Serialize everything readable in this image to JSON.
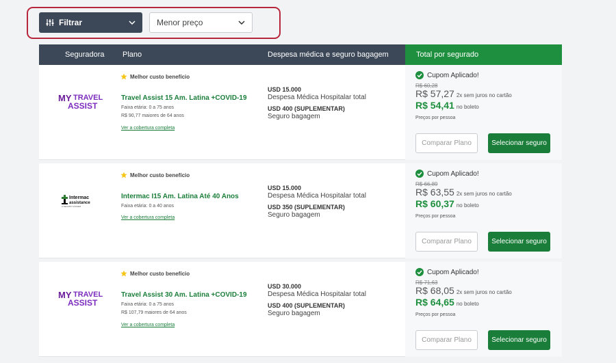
{
  "toolbar": {
    "filter_label": "Filtrar",
    "sort_value": "Menor preço"
  },
  "table_header": {
    "insurer": "Seguradora",
    "plan": "Plano",
    "coverage": "Despesa médica e seguro bagagem",
    "total": "Total por segurado"
  },
  "colors": {
    "dark": "#3c4858",
    "green": "#1e8f3e",
    "highlight": "#b8263c"
  },
  "cards": [
    {
      "logo": "MYTRAVEL ASSIST",
      "badge": "Melhor custo benefício",
      "name": "Travel Assist 15 Am. Latina +COVID-19",
      "age": "Faixa etária: 0 a 75 anos",
      "extra": "R$ 90,77 maiores de 64 anos",
      "link": "Ver a cobertura completa",
      "medical_amount": "USD 15.000",
      "medical_label": "Despesa Médica Hospitalar total",
      "baggage_amount": "USD 400 (SUPLEMENTAR)",
      "baggage_label": "Seguro bagagem",
      "coupon": "Cupom Aplicado!",
      "old_price": "R$ 60,28",
      "card_price": "R$ 57,27",
      "card_terms": "2x sem juros no cartão",
      "boleto_price": "R$ 54,41",
      "boleto_label": "no boleto",
      "per_person": "Preços por pessoa",
      "compare": "Comparar Plano",
      "select": "Selecionar seguro"
    },
    {
      "logo": "Intermac assistance",
      "badge": "Melhor custo benefício",
      "name": "Intermac I15 Am. Latina Até 40 Anos",
      "age": "Faixa etária: 0 a 40 anos",
      "extra": "",
      "link": "Ver a cobertura completa",
      "medical_amount": "USD 15.000",
      "medical_label": "Despesa Médica Hospitalar total",
      "baggage_amount": "USD 350 (SUPLEMENTAR)",
      "baggage_label": "Seguro bagagem",
      "coupon": "Cupom Aplicado!",
      "old_price": "R$ 66,89",
      "card_price": "R$ 63,55",
      "card_terms": "2x sem juros no cartão",
      "boleto_price": "R$ 60,37",
      "boleto_label": "no boleto",
      "per_person": "Preços por pessoa",
      "compare": "Comparar Plano",
      "select": "Selecionar seguro"
    },
    {
      "logo": "MYTRAVEL ASSIST",
      "badge": "Melhor custo benefício",
      "name": "Travel Assist 30 Am. Latina +COVID-19",
      "age": "Faixa etária: 0 a 75 anos",
      "extra": "R$ 107,79 maiores de 64 anos",
      "link": "Ver a cobertura completa",
      "medical_amount": "USD 30.000",
      "medical_label": "Despesa Médica Hospitalar total",
      "baggage_amount": "USD 400 (SUPLEMENTAR)",
      "baggage_label": "Seguro bagagem",
      "coupon": "Cupom Aplicado!",
      "old_price": "R$ 71,63",
      "card_price": "R$ 68,05",
      "card_terms": "2x sem juros no cartão",
      "boleto_price": "R$ 64,65",
      "boleto_label": "no boleto",
      "per_person": "Preços por pessoa",
      "compare": "Comparar Plano",
      "select": "Selecionar seguro"
    }
  ]
}
